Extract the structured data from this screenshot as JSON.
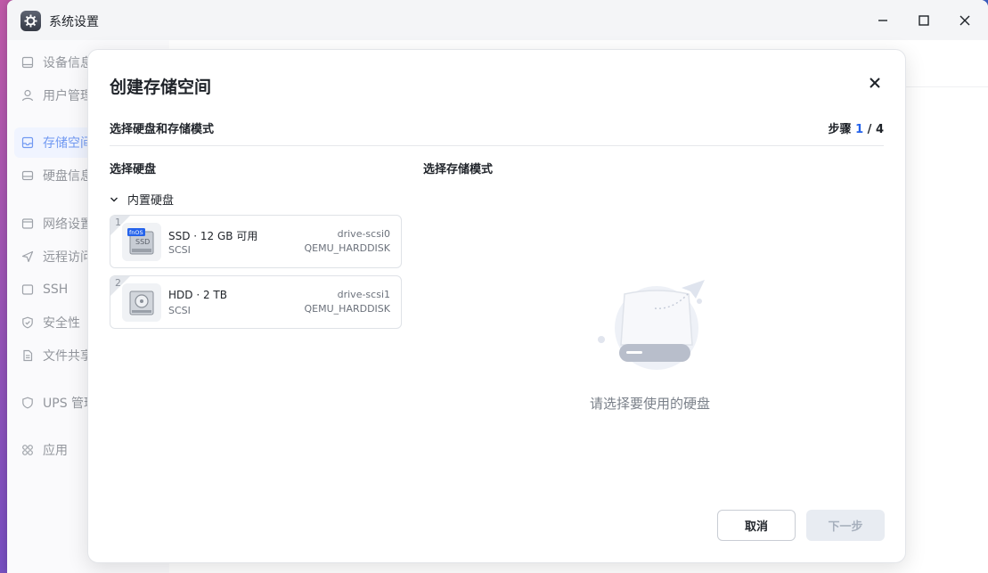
{
  "window": {
    "title": "系统设置",
    "app_icon": "gear-icon"
  },
  "sidebar": {
    "items": [
      {
        "label": "设备信息",
        "icon": "device-icon",
        "active": false
      },
      {
        "label": "用户管理",
        "icon": "user-icon",
        "active": false
      },
      {
        "label": "存储空间",
        "icon": "storage-icon",
        "active": true
      },
      {
        "label": "硬盘信息",
        "icon": "disk-icon",
        "active": false
      },
      {
        "label": "网络设置",
        "icon": "network-icon",
        "active": false
      },
      {
        "label": "远程访问",
        "icon": "send-icon",
        "active": false
      },
      {
        "label": "SSH",
        "icon": "terminal-icon",
        "active": false
      },
      {
        "label": "安全性",
        "icon": "shield-icon",
        "active": false
      },
      {
        "label": "文件共享",
        "icon": "file-icon",
        "active": false
      },
      {
        "label": "UPS 管理",
        "icon": "ups-icon",
        "active": false
      },
      {
        "label": "应用",
        "icon": "apps-icon",
        "active": false
      }
    ]
  },
  "dialog": {
    "title": "创建存储空间",
    "subtitle": "选择硬盘和存储模式",
    "steps": {
      "prefix": "步骤",
      "current": "1",
      "separator": "/",
      "total": "4"
    },
    "left_section": "选择硬盘",
    "right_section": "选择存储模式",
    "group_label": "内置硬盘",
    "disks": [
      {
        "index": "1",
        "name": "SSD · 12 GB 可用",
        "bus": "SCSI",
        "id": "drive-scsi0",
        "model": "QEMU_HARDDISK",
        "badge": "fnOS",
        "type": "SSD"
      },
      {
        "index": "2",
        "name": "HDD · 2 TB",
        "bus": "SCSI",
        "id": "drive-scsi1",
        "model": "QEMU_HARDDISK",
        "type": "HDD"
      }
    ],
    "empty_text": "请选择要使用的硬盘",
    "cancel_label": "取消",
    "next_label": "下一步"
  },
  "colors": {
    "accent": "#2563eb",
    "disabled_btn": "#e8ecf2"
  }
}
